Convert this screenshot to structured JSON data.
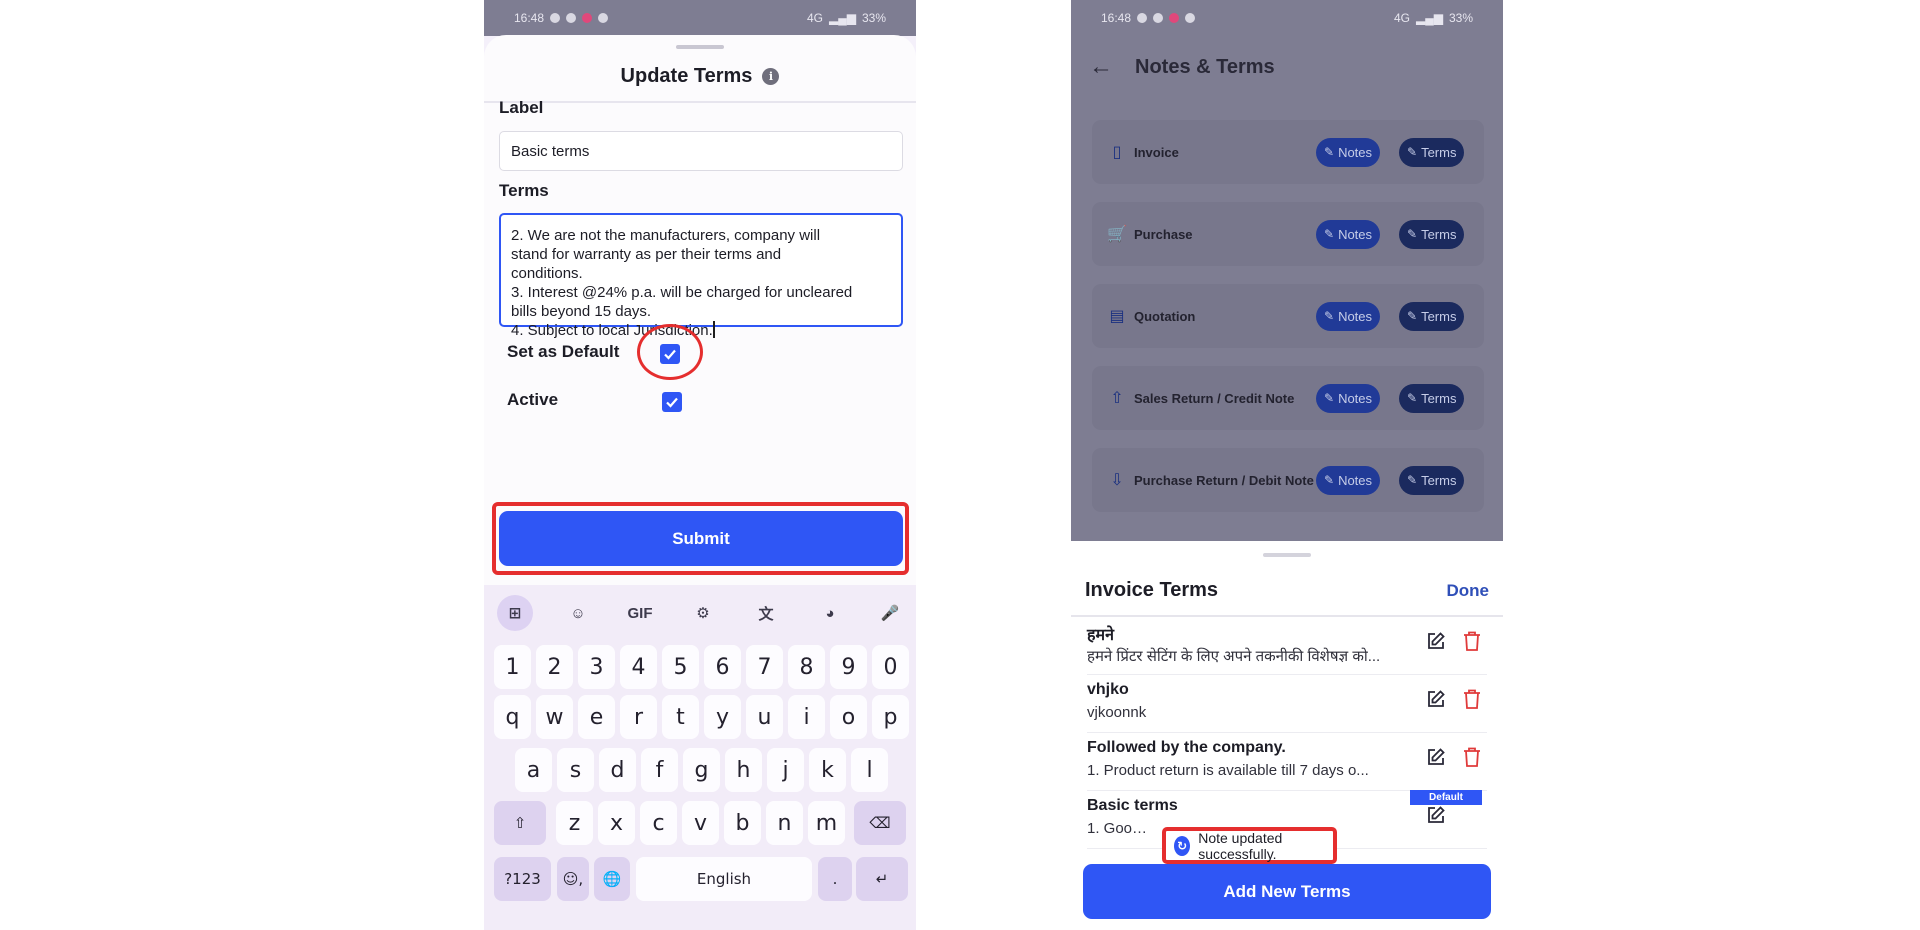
{
  "left_screen": {
    "status": {
      "time": "16:48",
      "network": "4G",
      "battery": "33%"
    },
    "sheet": {
      "title": "Update Terms",
      "info_glyph": "i",
      "label_heading": "Label",
      "label_value": "Basic terms",
      "terms_heading": "Terms",
      "terms_lines": [
        "2. We are not the manufacturers, company will",
        "stand for warranty as per their terms and",
        "conditions.",
        "3. Interest @24% p.a. will be charged for uncleared",
        "bills beyond 15 days.",
        "4. Subject to local Jurisdiction."
      ],
      "set_default_label": "Set as Default",
      "set_default_checked": true,
      "active_label": "Active",
      "active_checked": true,
      "submit_label": "Submit"
    },
    "keyboard": {
      "toolbar": [
        {
          "name": "apps-grid-icon",
          "glyph": "⊞",
          "active": true
        },
        {
          "name": "sticker-icon",
          "glyph": "☺"
        },
        {
          "name": "gif-button",
          "glyph": "GIF"
        },
        {
          "name": "settings-gear-icon",
          "glyph": "⚙"
        },
        {
          "name": "translate-icon",
          "glyph": "文"
        },
        {
          "name": "palette-icon",
          "glyph": "◕"
        },
        {
          "name": "microphone-icon",
          "glyph": "🎤"
        }
      ],
      "row_numbers": [
        "1",
        "2",
        "3",
        "4",
        "5",
        "6",
        "7",
        "8",
        "9",
        "0"
      ],
      "row_1": [
        "q",
        "w",
        "e",
        "r",
        "t",
        "y",
        "u",
        "i",
        "o",
        "p"
      ],
      "row_2": [
        "a",
        "s",
        "d",
        "f",
        "g",
        "h",
        "j",
        "k",
        "l"
      ],
      "row_3": [
        "z",
        "x",
        "c",
        "v",
        "b",
        "n",
        "m"
      ],
      "shift_glyph": "⇧",
      "backspace_glyph": "⌫",
      "symbols_label": "?123",
      "emoji_glyph": "☺",
      "comma_glyph": ",",
      "globe_glyph": "🌐",
      "space_label": "English",
      "period_label": ".",
      "enter_glyph": "↵"
    }
  },
  "right_screen": {
    "status": {
      "time": "16:48",
      "network": "4G",
      "battery": "33%"
    },
    "appbar": {
      "back_glyph": "←",
      "title": "Notes & Terms"
    },
    "documents": [
      {
        "label": "Invoice",
        "icon": "invoice-icon",
        "glyph": "▯"
      },
      {
        "label": "Purchase",
        "icon": "cart-icon",
        "glyph": "🛒"
      },
      {
        "label": "Quotation",
        "icon": "clipboard-icon",
        "glyph": "▤"
      },
      {
        "label": "Sales Return / Credit Note",
        "icon": "upload-icon",
        "glyph": "⇧"
      },
      {
        "label": "Purchase Return / Debit Note",
        "icon": "download-icon",
        "glyph": "⇩"
      }
    ],
    "notes_label": "Notes",
    "terms_label": "Terms",
    "sheet": {
      "title": "Invoice Terms",
      "done_label": "Done",
      "terms": [
        {
          "name": "हमने",
          "text": "हमने प्रिंटर सेटिंग के लिए अपने तकनीकी विशेषज्ञ को...",
          "deletable": true
        },
        {
          "name": "vhjko",
          "text": "vjkoonnk",
          "deletable": true
        },
        {
          "name": "Followed by the company.",
          "text": "1. Product return is available till 7 days o...",
          "deletable": true
        },
        {
          "name": "Basic terms",
          "text": "1. Goods o",
          "deletable": false
        }
      ],
      "default_badge": "Default",
      "toast_message": "Note updated successfully.",
      "add_button_label": "Add New Terms"
    }
  },
  "colors": {
    "primary": "#2f56f5",
    "highlight_red": "#e52e2e",
    "scrim": "#7e7d92"
  }
}
